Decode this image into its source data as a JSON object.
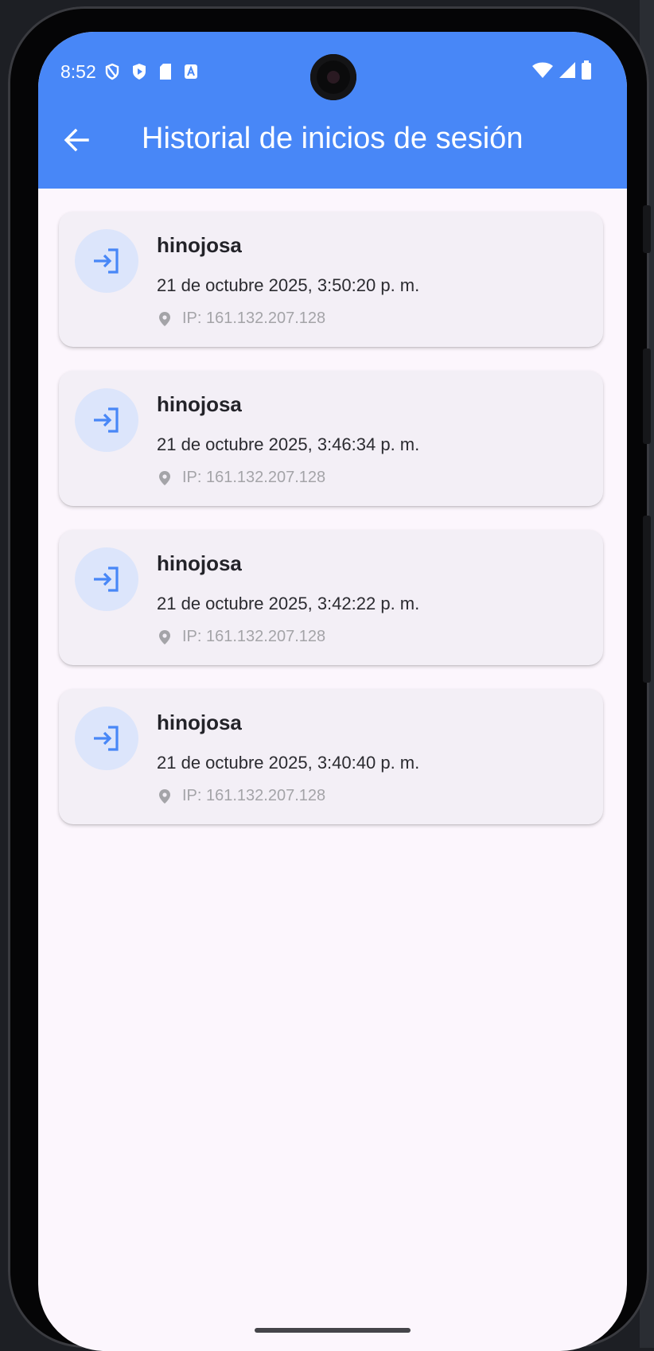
{
  "status_bar": {
    "time": "8:52"
  },
  "header": {
    "title": "Historial de inicios de sesión"
  },
  "sessions": [
    {
      "user": "hinojosa",
      "date": "21 de octubre 2025, 3:50:20 p. m.",
      "ip": "IP: 161.132.207.128"
    },
    {
      "user": "hinojosa",
      "date": "21 de octubre 2025, 3:46:34 p. m.",
      "ip": "IP: 161.132.207.128"
    },
    {
      "user": "hinojosa",
      "date": "21 de octubre 2025, 3:42:22 p. m.",
      "ip": "IP: 161.132.207.128"
    },
    {
      "user": "hinojosa",
      "date": "21 de octubre 2025, 3:40:40 p. m.",
      "ip": "IP: 161.132.207.128"
    }
  ],
  "icons": {
    "back": "arrow-back-icon",
    "entry": "login-icon",
    "location": "location-pin-icon"
  },
  "colors": {
    "app_bar": "#4887f7",
    "background": "#fcf6fd",
    "card": "#f3eff6",
    "icon_circle": "#dce5fb",
    "icon": "#4887f7"
  }
}
